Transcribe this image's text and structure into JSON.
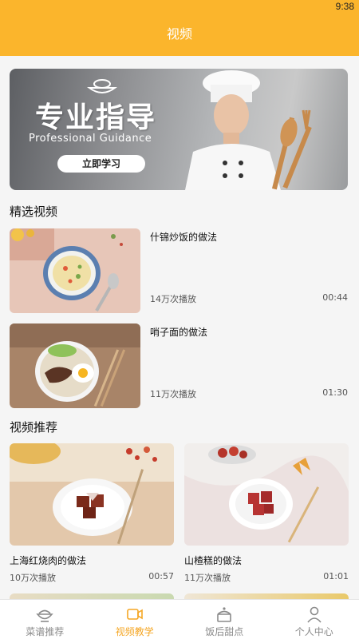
{
  "status": {
    "time": "9:38"
  },
  "header": {
    "title": "视频"
  },
  "banner": {
    "headline": "专业指导",
    "subtitle": "Professional Guidance",
    "cta_label": "立即学习"
  },
  "featured": {
    "title": "精选视频",
    "items": [
      {
        "name": "什锦炒饭的做法",
        "plays": "14万次播放",
        "duration": "00:44"
      },
      {
        "name": "哨子面的做法",
        "plays": "11万次播放",
        "duration": "01:30"
      }
    ]
  },
  "recommended": {
    "title": "视频推荐",
    "items": [
      {
        "name": "上海红烧肉的做法",
        "plays": "10万次播放",
        "duration": "00:57"
      },
      {
        "name": "山楂糕的做法",
        "plays": "11万次播放",
        "duration": "01:01"
      }
    ]
  },
  "tabbar": {
    "items": [
      {
        "label": "菜谱推荐",
        "icon": "bowl-icon",
        "active": false
      },
      {
        "label": "视频教学",
        "icon": "video-icon",
        "active": true
      },
      {
        "label": "饭后甜点",
        "icon": "cake-icon",
        "active": false
      },
      {
        "label": "个人中心",
        "icon": "person-icon",
        "active": false
      }
    ]
  },
  "colors": {
    "accent": "#fbb52c",
    "active_tab": "#f5a623"
  }
}
